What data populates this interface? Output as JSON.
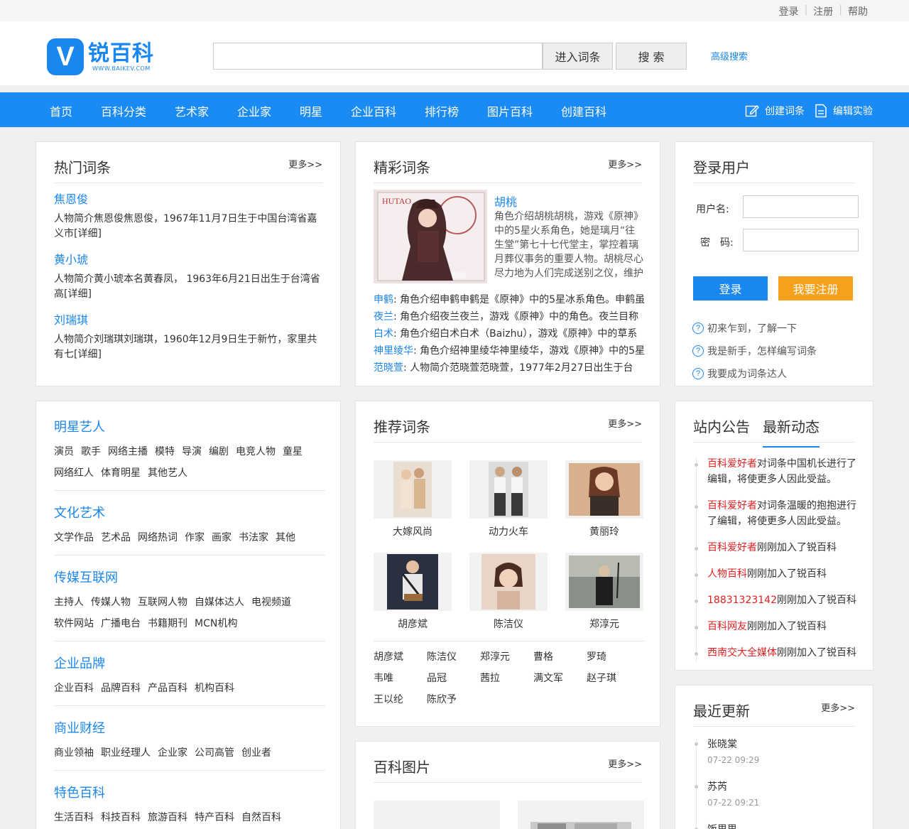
{
  "topbar": {
    "login": "登录",
    "register": "注册",
    "help": "帮助"
  },
  "header": {
    "logo_mark": "V",
    "logo_name": "锐百科",
    "logo_url": "WWW.BAIKEV.COM",
    "search_placeholder": "",
    "enter_label": "进入词条",
    "search_label": "搜 索",
    "advanced_label": "高级搜索"
  },
  "nav": {
    "items": [
      "首页",
      "百科分类",
      "艺术家",
      "企业家",
      "明星",
      "企业百科",
      "排行榜",
      "图片百科",
      "创建百科"
    ],
    "create_entry": "创建词条",
    "edit_lab": "编辑实验"
  },
  "hot": {
    "title": "热门词条",
    "more": "更多>>",
    "entries": [
      {
        "title": "焦恩俊",
        "desc": "人物简介焦恩俊焦恩俊，1967年11月7日生于中国台湾省嘉义市[详细]"
      },
      {
        "title": "黄小琥",
        "desc": "人物简介黄小琥本名黄春凤， 1963年6月21日出生于台湾省高[详细]"
      },
      {
        "title": "刘瑞琪",
        "desc": "人物简介刘瑞琪刘瑞琪，1960年12月9日生于新竹，家里共有七[详细]"
      }
    ]
  },
  "featured": {
    "title": "精彩词条",
    "more": "更多>>",
    "main_title": "胡桃",
    "main_desc": "角色介绍胡桃胡桃，游戏《原神》中的5星火系角色，她是璃月“往生堂”第七十七代堂主，掌控着璃月葬仪事务的重要人物。胡桃尽心尽力地为人们完成送别之仪，维护着",
    "image_text_a": "HUTAO",
    "image_text_b": "胡桃",
    "rows": [
      {
        "name": "申鹤",
        "text": ": 角色介绍申鹤申鹤是《原神》中的5星冰系角色。申鹤虽"
      },
      {
        "name": "夜兰",
        "text": ": 角色介绍夜兰夜兰，游戏《原神》中的角色。夜兰目称"
      },
      {
        "name": "白术",
        "text": ": 角色介绍白术白术（Baizhu），游戏《原神》中的草系"
      },
      {
        "name": "神里绫华",
        "text": ": 角色介绍神里绫华神里绫华，游戏《原神》中的5星"
      },
      {
        "name": "范晓萱",
        "text": ": 人物简介范晓萱范晓萱，1977年2月27日出生于台"
      }
    ]
  },
  "login": {
    "title": "登录用户",
    "username_label": "用户名:",
    "password_label": "密　码:",
    "login_btn": "登录",
    "register_btn": "我要注册",
    "help": [
      "初来乍到，了解一下",
      "我是新手，怎样编写词条",
      "我要成为词条达人"
    ]
  },
  "categories": [
    {
      "title": "明星艺人",
      "tags": [
        "演员",
        "歌手",
        "网络主播",
        "模特",
        "导演",
        "编剧",
        "电竞人物",
        "童星",
        "网络红人",
        "体育明星",
        "其他艺人"
      ]
    },
    {
      "title": "文化艺术",
      "tags": [
        "文学作品",
        "艺术品",
        "网络热词",
        "作家",
        "画家",
        "书法家",
        "其他"
      ]
    },
    {
      "title": "传媒互联网",
      "tags": [
        "主持人",
        "传媒人物",
        "互联网人物",
        "自媒体达人",
        "电视频道",
        "软件网站",
        "广播电台",
        "书籍期刊",
        "MCN机构"
      ]
    },
    {
      "title": "企业品牌",
      "tags": [
        "企业百科",
        "品牌百科",
        "产品百科",
        "机构百科"
      ]
    },
    {
      "title": "商业财经",
      "tags": [
        "商业领袖",
        "职业经理人",
        "企业家",
        "公司高管",
        "创业者"
      ]
    },
    {
      "title": "特色百科",
      "tags": [
        "生活百科",
        "科技百科",
        "旅游百科",
        "特产百科",
        "自然百科"
      ]
    }
  ],
  "recommended": {
    "title": "推荐词条",
    "more": "更多>>",
    "cards": [
      "大嫁风尚",
      "动力火车",
      "黄丽玲",
      "胡彦斌",
      "陈洁仪",
      "郑淳元"
    ],
    "names": [
      "胡彦斌",
      "陈洁仪",
      "郑淳元",
      "曹格",
      "罗琦",
      "韦唯",
      "品冠",
      "茜拉",
      "满文军",
      "赵子琪",
      "王以纶",
      "陈欣予"
    ]
  },
  "notice": {
    "tab1": "站内公告",
    "tab2": "最新动态",
    "items": [
      {
        "user": "百科爱好者",
        "text": "对词条中国机长进行了编辑，将使更多人因此受益。"
      },
      {
        "user": "百科爱好者",
        "text": "对词条温暖的抱抱进行了编辑，将使更多人因此受益。"
      },
      {
        "user": "百科爱好者",
        "text": "刚刚加入了锐百科"
      },
      {
        "user": "人物百科",
        "text": "刚刚加入了锐百科"
      },
      {
        "user": "18831323142",
        "text": "刚刚加入了锐百科"
      },
      {
        "user": "百科网友",
        "text": "刚刚加入了锐百科"
      },
      {
        "user": "西南交大全媒体",
        "text": "刚刚加入了锐百科"
      }
    ]
  },
  "recent": {
    "title": "最近更新",
    "more": "更多>>",
    "items": [
      {
        "name": "张晓棠",
        "time": "07-22 09:29"
      },
      {
        "name": "苏芮",
        "time": "07-22 09:21"
      },
      {
        "name": "饭思思",
        "time": ""
      }
    ]
  },
  "pictures": {
    "title": "百科图片",
    "more": "更多>>"
  }
}
